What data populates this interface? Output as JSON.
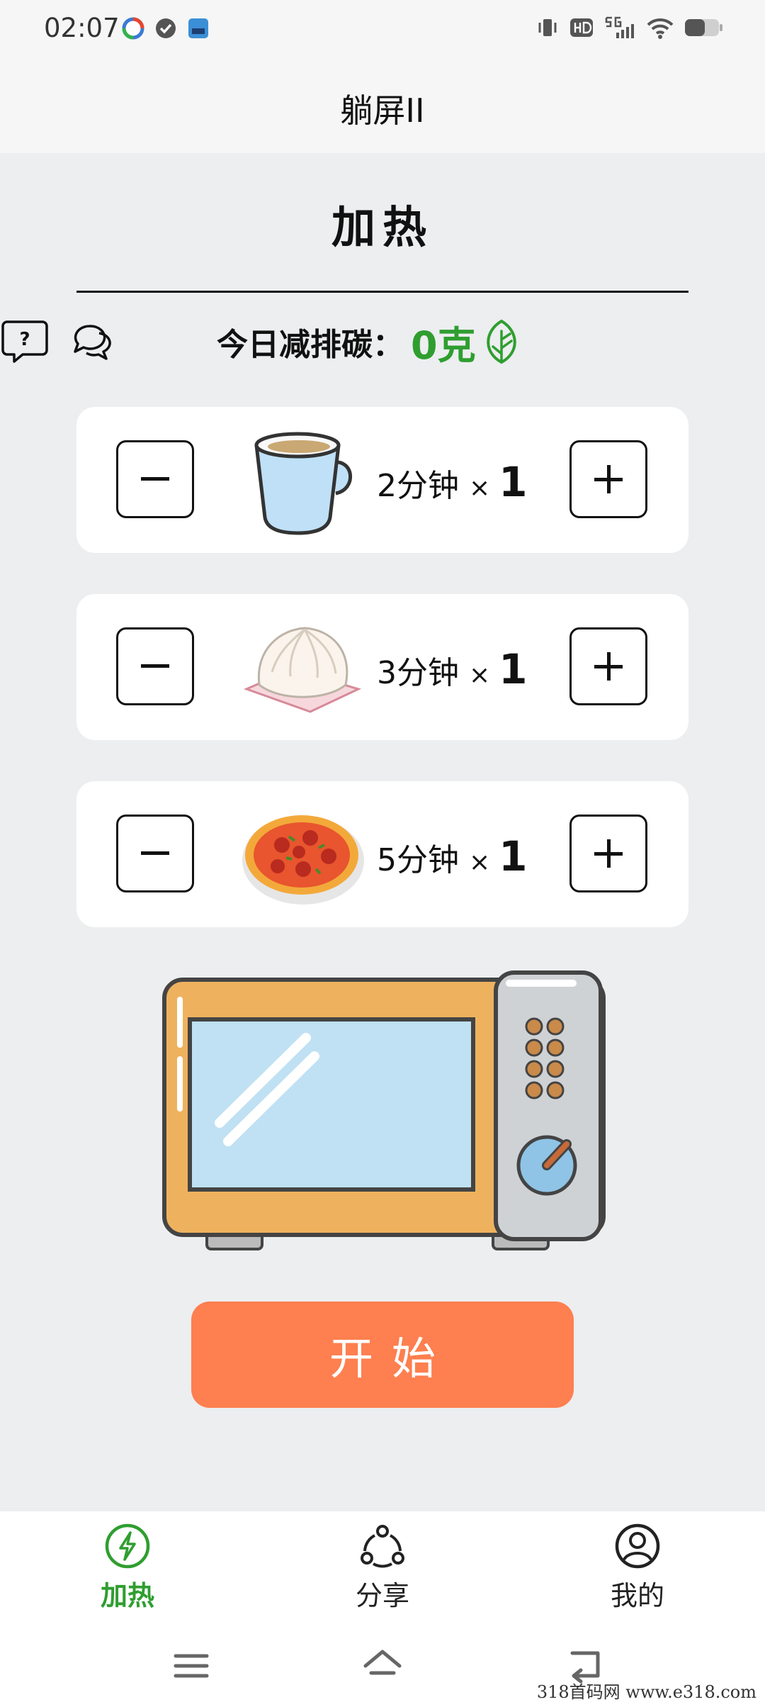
{
  "status": {
    "time": "02:07"
  },
  "app": {
    "title": "躺屏II"
  },
  "page": {
    "title": "加热"
  },
  "carbon": {
    "label": "今日减排碳：",
    "value": "0克"
  },
  "items": [
    {
      "food_icon": "mug-icon",
      "time": "2分钟",
      "times_sign": "×",
      "count": "1"
    },
    {
      "food_icon": "bun-icon",
      "time": "3分钟",
      "times_sign": "×",
      "count": "1"
    },
    {
      "food_icon": "pizza-icon",
      "time": "5分钟",
      "times_sign": "×",
      "count": "1"
    }
  ],
  "start_button": "开始",
  "nav": [
    {
      "label": "加热",
      "icon": "bolt-circle-icon",
      "active": true
    },
    {
      "label": "分享",
      "icon": "share-icon",
      "active": false
    },
    {
      "label": "我的",
      "icon": "user-circle-icon",
      "active": false
    }
  ],
  "watermark": "318首码网  www.e318.com",
  "colors": {
    "accent_green": "#2f9e2f",
    "start_orange": "#fe7f4f",
    "background": "#eceef0"
  }
}
